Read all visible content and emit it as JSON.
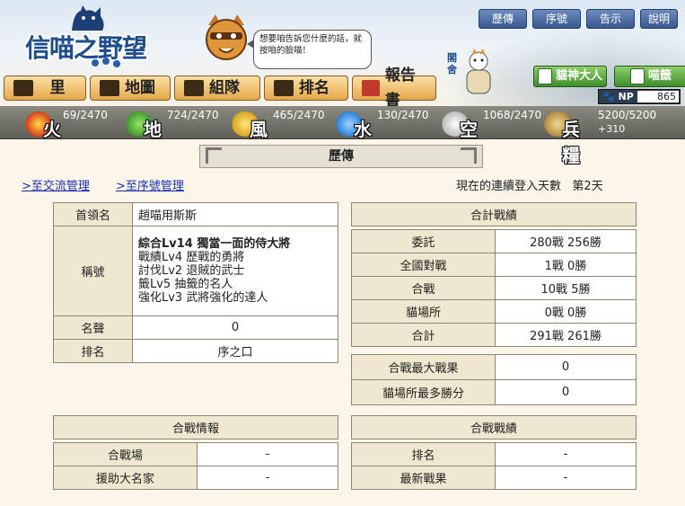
{
  "header": {
    "logo_text": "信喵之野望",
    "speech": "想要咱告訴您什麼的話，就按咱的臉喵！",
    "top_buttons": [
      "歷傳",
      "序號",
      "告示",
      "說明"
    ],
    "nav": [
      "里",
      "地圖",
      "組隊",
      "排名",
      "報告書"
    ],
    "sage_label": "閣舍",
    "god_button": "貓神大人",
    "meow_button": "喵籤",
    "np_label": "NP",
    "np_value": "865"
  },
  "resources": [
    {
      "name": "火",
      "value": "69/2470",
      "color": "#d93a1a"
    },
    {
      "name": "地",
      "value": "724/2470",
      "color": "#3e9a2a"
    },
    {
      "name": "風",
      "value": "465/2470",
      "color": "#d9a21a"
    },
    {
      "name": "水",
      "value": "130/2470",
      "color": "#2a7fd9"
    },
    {
      "name": "空",
      "value": "1068/2470",
      "color": "#dddddd"
    },
    {
      "name": "兵糧",
      "value": "5200/5200",
      "sub": "+310",
      "color": "#b58a3a"
    }
  ],
  "page": {
    "title": "歷傳",
    "link_exchange": ">至交流管理",
    "link_serial": ">至序號管理",
    "login_label": "現在的連續登入天數",
    "login_value": "第2天"
  },
  "profile": {
    "leader_label": "首領名",
    "leader_value": "趙喵用斯斯",
    "title_label": "稱號",
    "titles": [
      "綜合Lv14 獨當一面的侍大將",
      "戰績Lv4 歷戰的勇將",
      "討伐Lv2 退賊的武士",
      "籤Lv5 抽籤的名人",
      "強化Lv3 武將強化的達人"
    ],
    "fame_label": "名聲",
    "fame_value": "0",
    "rank_label": "排名",
    "rank_value": "序之口"
  },
  "totals": {
    "header": "合計戰績",
    "rows": [
      {
        "label": "委託",
        "value": "280戰 256勝"
      },
      {
        "label": "全國對戰",
        "value": "1戰 0勝"
      },
      {
        "label": "合戰",
        "value": "10戰 5勝"
      },
      {
        "label": "貓場所",
        "value": "0戰 0勝"
      },
      {
        "label": "合計",
        "value": "291戰 261勝"
      }
    ],
    "max_label": "合戰最大戰果",
    "max_value": "0",
    "most_label": "貓場所最多勝分",
    "most_value": "0"
  },
  "battle_info": {
    "header": "合戰情報",
    "field_label": "合戰場",
    "field_value": "-",
    "ally_label": "援助大名家",
    "ally_value": "-"
  },
  "battle_record": {
    "header": "合戰戰績",
    "rank_label": "排名",
    "rank_value": "-",
    "latest_label": "最新戰果",
    "latest_value": "-"
  }
}
